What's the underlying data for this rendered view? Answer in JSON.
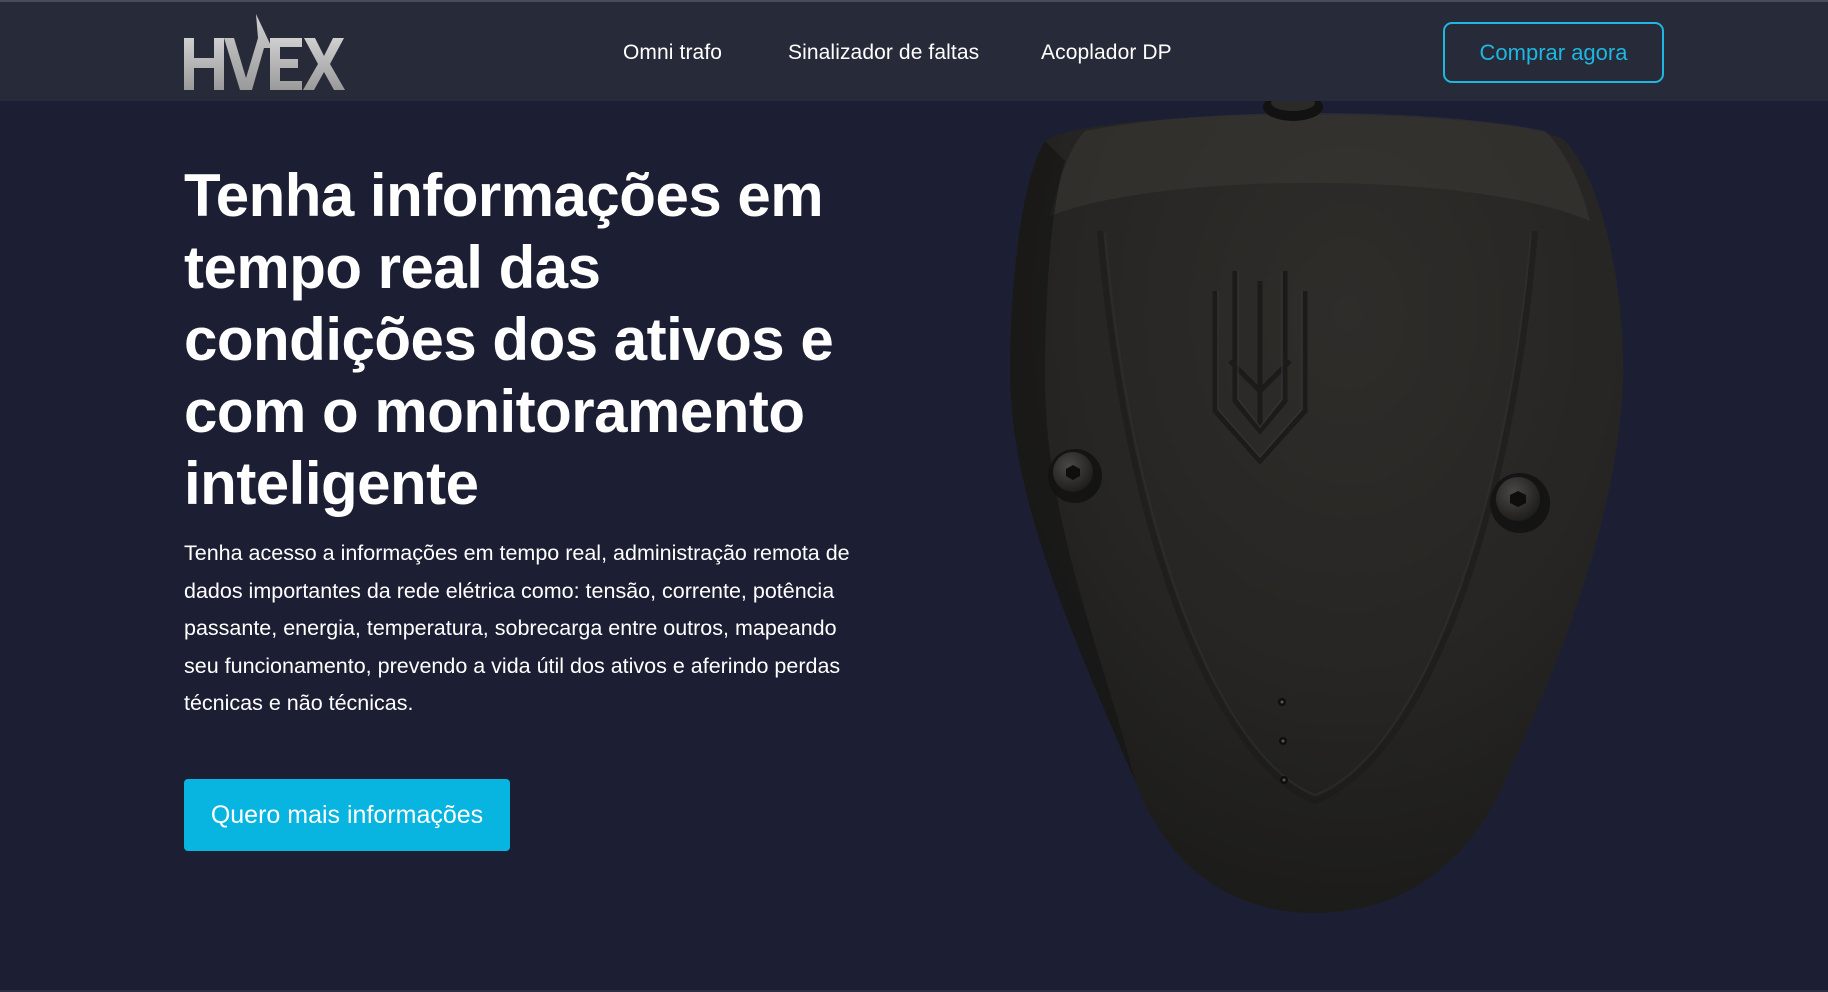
{
  "brand": {
    "logo_text": "HVEX"
  },
  "nav": {
    "items": [
      {
        "label": "Omni trafo"
      },
      {
        "label": "Sinalizador de faltas"
      },
      {
        "label": "Acoplador DP"
      }
    ],
    "buy_button": "Comprar agora"
  },
  "hero": {
    "title": "Tenha informações em tempo real das condições dos ativos e com o monitoramento inteligente",
    "description": "Tenha acesso a informações em tempo real, administração remota de dados importantes da rede elétrica como: tensão, corrente, potência passante, energia, temperatura, sobrecarga entre outros, mapeando seu funcionamento, prevendo a vida útil dos ativos e aferindo perdas técnicas e não técnicas.",
    "cta_button": "Quero mais informações"
  },
  "colors": {
    "background": "#1c1f33",
    "navbar": "#272a38",
    "accent": "#08b4e0",
    "buy_border": "#1fb6df"
  }
}
